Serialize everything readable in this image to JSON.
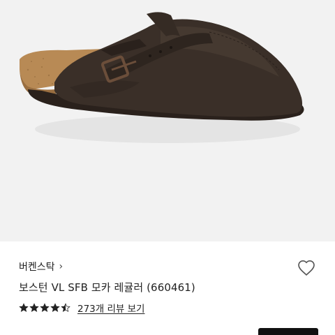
{
  "product": {
    "brand": "버켄스탁",
    "name": "보스턴 VL SFB 모카 레귤러 (660461)",
    "rating_value": 4.5,
    "rating_max": 5,
    "review_text": "273개 리뷰 보기"
  },
  "icons": {
    "brand_chevron": "chevron-right-icon",
    "wishlist": "heart-outline-icon",
    "star": "star-icon"
  },
  "colors": {
    "image_background": "#f2f2f2",
    "shoe_suede": "#3a2f28",
    "cork": "#b88a55",
    "star": "#222222"
  }
}
